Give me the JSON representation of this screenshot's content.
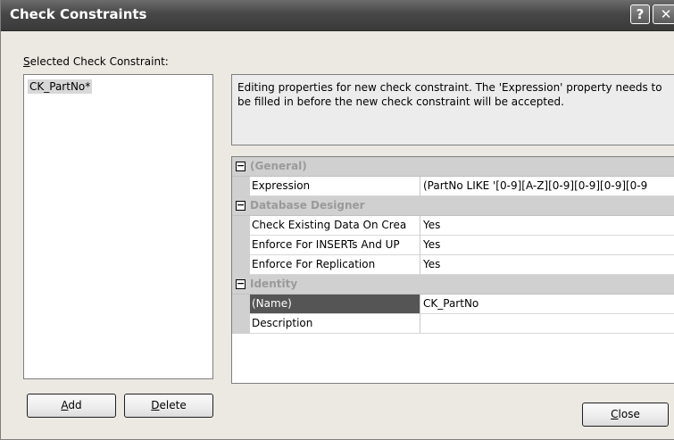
{
  "window": {
    "title": "Check Constraints"
  },
  "titlebar": {
    "help_glyph": "?",
    "close_glyph": "✕"
  },
  "selected_label": "Selected Check Constraint:",
  "constraints": [
    {
      "label": "CK_PartNo*"
    }
  ],
  "buttons": {
    "add": "Add",
    "delete": "Delete",
    "close": "Close"
  },
  "info_text": "Editing properties for new check constraint.  The 'Expression' property needs to be filled in before the new check constraint will be accepted.",
  "property_grid": {
    "toggle_glyph": "−",
    "categories": [
      {
        "name": "(General)",
        "properties": [
          {
            "name": "Expression",
            "value": "(PartNo LIKE '[0-9][A-Z][0-9][0-9][0-9][0-9"
          }
        ]
      },
      {
        "name": "Database Designer",
        "properties": [
          {
            "name": "Check Existing Data On Crea",
            "value": "Yes"
          },
          {
            "name": "Enforce For INSERTs And UP",
            "value": "Yes"
          },
          {
            "name": "Enforce For Replication",
            "value": "Yes"
          }
        ]
      },
      {
        "name": "Identity",
        "properties": [
          {
            "name": "(Name)",
            "value": "CK_PartNo"
          },
          {
            "name": "Description",
            "value": ""
          }
        ]
      }
    ]
  },
  "colors": {
    "titlebar": "#474747",
    "dialog_bg": "#ece9e3",
    "selected_row": "#555555"
  }
}
